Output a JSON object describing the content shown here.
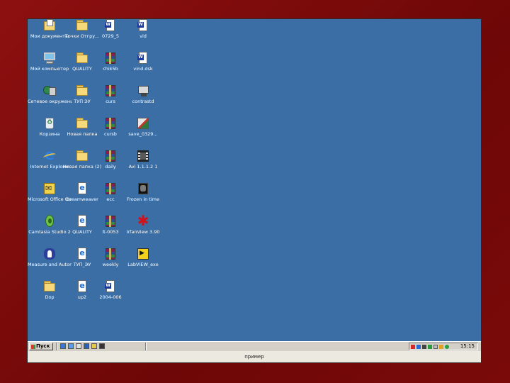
{
  "desktop": {
    "icons": [
      {
        "label": "Мои документы",
        "icon": "my-documents-icon"
      },
      {
        "label": "Мой компьютер",
        "icon": "my-computer-icon"
      },
      {
        "label": "Сетевое окружение",
        "icon": "network-icon"
      },
      {
        "label": "Корзина",
        "icon": "recycle-bin-icon"
      },
      {
        "label": "Internet Explorer",
        "icon": "internet-explorer-icon"
      },
      {
        "label": "Microsoft Office Outlook",
        "icon": "outlook-icon"
      },
      {
        "label": "Camtasia Studio 2",
        "icon": "camtasia-icon"
      },
      {
        "label": "Measure and Automation",
        "icon": "measurement-automation-icon"
      },
      {
        "label": "Dop",
        "icon": "folder-icon"
      },
      {
        "label": "Точки Отгру...",
        "icon": "folder-icon"
      },
      {
        "label": "QUALITY",
        "icon": "folder-icon"
      },
      {
        "label": "ТУП ЭУ",
        "icon": "folder-icon"
      },
      {
        "label": "Новая папка",
        "icon": "folder-icon"
      },
      {
        "label": "Новая папка (2)",
        "icon": "folder-icon"
      },
      {
        "label": "Dreamweaver",
        "icon": "web-document-icon"
      },
      {
        "label": "QUALITY",
        "icon": "web-document-icon"
      },
      {
        "label": "ТУП_ЭУ",
        "icon": "web-document-icon"
      },
      {
        "label": "up2",
        "icon": "web-document-icon"
      },
      {
        "label": "0729_5",
        "icon": "document-icon"
      },
      {
        "label": "chik5b",
        "icon": "archive-icon"
      },
      {
        "label": "curs",
        "icon": "archive-icon"
      },
      {
        "label": "cursb",
        "icon": "archive-icon"
      },
      {
        "label": "daily",
        "icon": "archive-icon"
      },
      {
        "label": "ecc",
        "icon": "archive-icon"
      },
      {
        "label": "lt-0053",
        "icon": "archive-icon"
      },
      {
        "label": "weekly",
        "icon": "archive-icon"
      },
      {
        "label": "2004-006",
        "icon": "document-icon"
      },
      {
        "label": "vid",
        "icon": "document-icon"
      },
      {
        "label": "vind.dsk",
        "icon": "document-icon"
      },
      {
        "label": "contrastd",
        "icon": "application-icon"
      },
      {
        "label": "save_0329...",
        "icon": "photo-icon"
      },
      {
        "label": "Avi 1.1.1.2 1",
        "icon": "video-icon"
      },
      {
        "label": "Frozen in time",
        "icon": "film-icon"
      },
      {
        "label": "IrfanView 3.90",
        "icon": "irfanview-icon"
      },
      {
        "label": "LabVIEW_exe",
        "icon": "labview-icon"
      }
    ]
  },
  "taskbar": {
    "start_label": "Пуск",
    "clock": "15:15"
  },
  "caption": "пример"
}
